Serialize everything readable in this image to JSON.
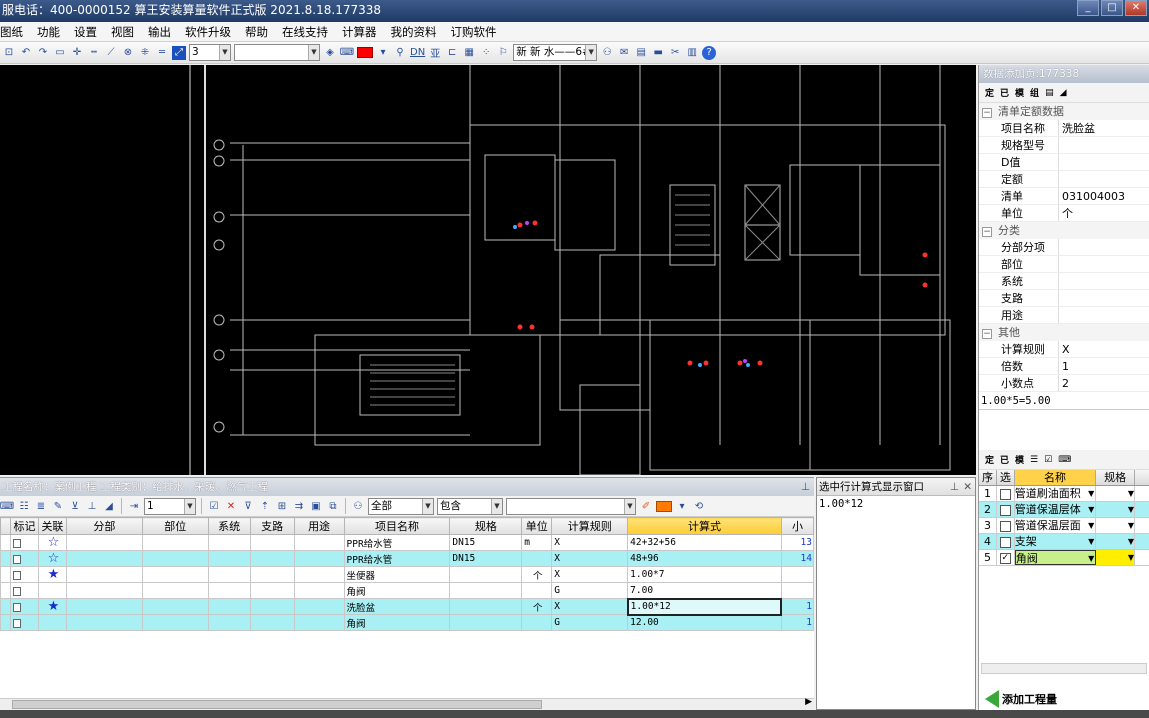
{
  "title": "服电话：400-0000152    算王安装算量软件正式版 2021.8.18.177338",
  "menu": [
    "图纸",
    "功能",
    "设置",
    "视图",
    "输出",
    "软件升级",
    "帮助",
    "在线支持",
    "计算器",
    "我的资料",
    "订购软件"
  ],
  "toolbar": {
    "scale_value": "3",
    "style_label": "新 新 水——6#",
    "dn_label": "DN"
  },
  "right_panel": {
    "title": "数据添加页:177338",
    "mini_tb": [
      "定",
      "已",
      "模",
      "组"
    ],
    "sections": [
      {
        "name": "清单定额数据",
        "rows": [
          [
            "项目名称",
            "洗脸盆"
          ],
          [
            "规格型号",
            ""
          ],
          [
            "D值",
            ""
          ],
          [
            "定额",
            ""
          ],
          [
            "清单",
            "031004003"
          ],
          [
            "单位",
            "个"
          ]
        ]
      },
      {
        "name": "分类",
        "rows": [
          [
            "分部分项",
            ""
          ],
          [
            "部位",
            ""
          ],
          [
            "系统",
            ""
          ],
          [
            "支路",
            ""
          ],
          [
            "用途",
            ""
          ]
        ]
      },
      {
        "name": "其他",
        "rows": [
          [
            "计算规则",
            "X"
          ],
          [
            "倍数",
            "1"
          ],
          [
            "小数点",
            "2"
          ]
        ]
      }
    ],
    "formula": "1.00*5=5.00",
    "grid_tb": [
      "定",
      "已",
      "模"
    ],
    "grid_headers": [
      "序",
      "选",
      "名称",
      "规格"
    ],
    "grid_rows": [
      {
        "no": "1",
        "checked": false,
        "name": "管道刷油面积"
      },
      {
        "no": "2",
        "checked": false,
        "name": "管道保温层体"
      },
      {
        "no": "3",
        "checked": false,
        "name": "管道保温层面"
      },
      {
        "no": "4",
        "checked": false,
        "name": "支架"
      },
      {
        "no": "5",
        "checked": true,
        "name": "角阀"
      }
    ],
    "add_button": "添加工程量"
  },
  "bottom": {
    "title": "工程名称：案例工程  工程类别：给排水、采暖、燃气工程",
    "filter_value": "1",
    "filter_all": "全部",
    "filter_contain": "包含",
    "headers": [
      "标记",
      "关联",
      "分部",
      "部位",
      "系统",
      "支路",
      "用途",
      "项目名称",
      "规格",
      "单位",
      "计算规则",
      "计算式",
      "小"
    ],
    "rows": [
      {
        "star": "",
        "name": "PPR给水管",
        "spec": "DN15",
        "unit": "m",
        "rule": "X",
        "formula": "42+32+56",
        "extra": "13"
      },
      {
        "star": "☆",
        "name": "PPR给水管",
        "spec": "DN15",
        "unit": "",
        "rule": "X",
        "formula": "48+96",
        "extra": "14"
      },
      {
        "star": "★",
        "name": "坐便器",
        "spec": "",
        "unit": "个",
        "rule": "X",
        "formula": "1.00*7",
        "extra": ""
      },
      {
        "star": "",
        "name": "角阀",
        "spec": "",
        "unit": "",
        "rule": "G",
        "formula": "7.00",
        "extra": ""
      },
      {
        "star": "★",
        "name": "洗脸盆",
        "spec": "",
        "unit": "个",
        "rule": "X",
        "formula": "1.00*12",
        "extra": "1"
      },
      {
        "star": "",
        "name": "角阀",
        "spec": "",
        "unit": "",
        "rule": "G",
        "formula": "12.00",
        "extra": "1"
      }
    ],
    "first_star": "☆"
  },
  "formula_panel": {
    "title": "选中行计算式显示窗口",
    "content": "1.00*12"
  }
}
